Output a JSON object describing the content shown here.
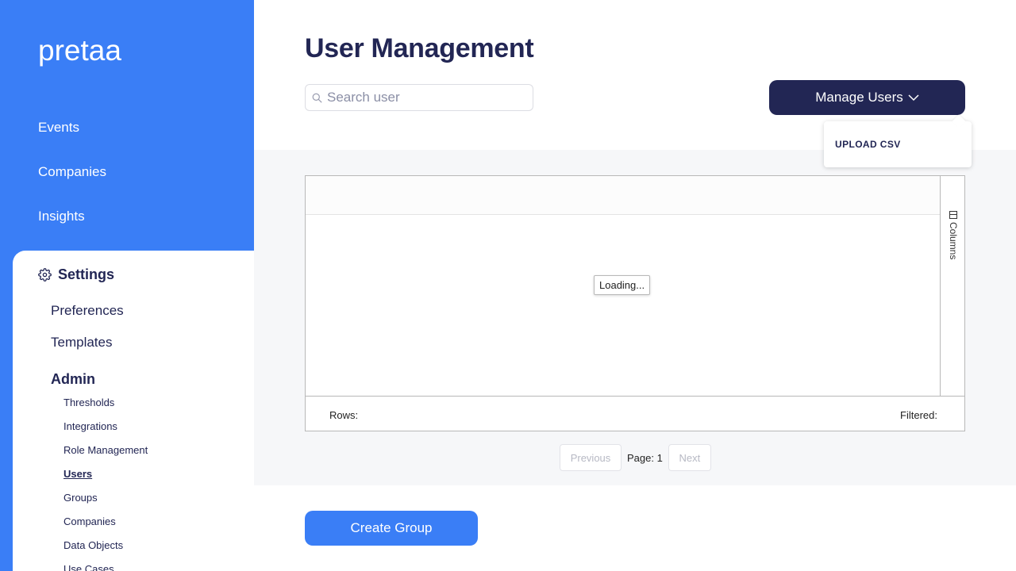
{
  "brand": {
    "logo_text": "pretaa",
    "primary_color": "#3a7ef6",
    "dark_color": "#222654"
  },
  "sidebar": {
    "items": [
      {
        "label": "Events"
      },
      {
        "label": "Companies"
      },
      {
        "label": "Insights"
      }
    ],
    "settings": {
      "label": "Settings",
      "icon": "gear-icon",
      "items": [
        {
          "label": "Preferences"
        },
        {
          "label": "Templates"
        }
      ],
      "admin": {
        "label": "Admin",
        "items": [
          {
            "label": "Thresholds"
          },
          {
            "label": "Integrations"
          },
          {
            "label": "Role Management"
          },
          {
            "label": "Users",
            "active": true
          },
          {
            "label": "Groups"
          },
          {
            "label": "Companies"
          },
          {
            "label": "Data Objects"
          },
          {
            "label": "Use Cases"
          }
        ]
      }
    }
  },
  "main": {
    "title": "User Management",
    "search": {
      "placeholder": "Search user",
      "value": ""
    },
    "manage_button": {
      "label": "Manage Users"
    },
    "dropdown": {
      "items": [
        {
          "label": "UPLOAD CSV"
        }
      ]
    },
    "grid": {
      "loading_text": "Loading...",
      "side_tab_label": "Columns",
      "rows_label": "Rows:",
      "filtered_label": "Filtered:"
    },
    "pagination": {
      "previous_label": "Previous",
      "page_label": "Page: 1",
      "next_label": "Next"
    },
    "create_group_button": {
      "label": "Create Group"
    }
  }
}
